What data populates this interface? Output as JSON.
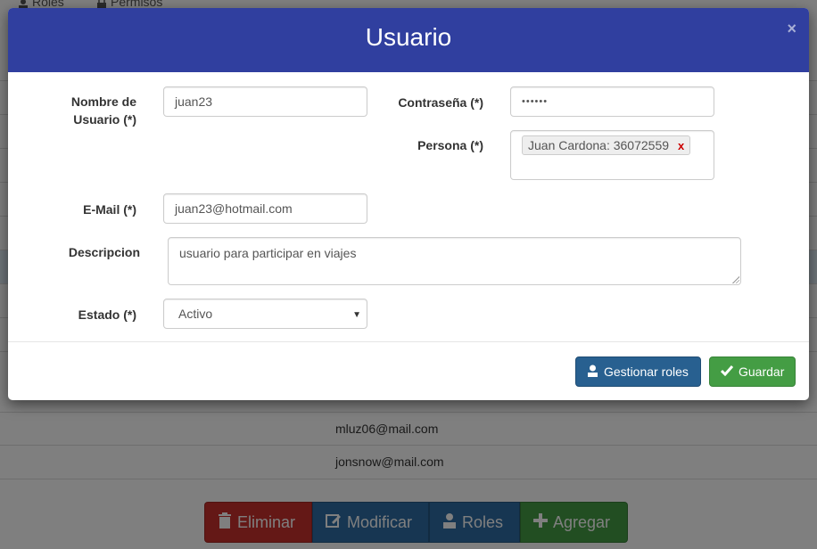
{
  "background": {
    "tabs": [
      {
        "label": "Roles",
        "icon": "user-icon"
      },
      {
        "label": "Permisos",
        "icon": "lock-icon"
      }
    ],
    "emails": [
      "mluz06@mail.com",
      "jonsnow@mail.com"
    ],
    "buttons": {
      "delete": "Eliminar",
      "modify": "Modificar",
      "roles": "Roles",
      "add": "Agregar"
    }
  },
  "modal": {
    "title": "Usuario",
    "close_icon": "×",
    "fields": {
      "username_label": "Nombre de Usuario (*)",
      "username_value": "juan23",
      "password_label": "Contraseña (*)",
      "password_value": "••••••",
      "persona_label": "Persona (*)",
      "persona_tag": "Juan Cardona: 36072559",
      "persona_tag_remove": "x",
      "email_label": "E-Mail (*)",
      "email_value": "juan23@hotmail.com",
      "description_label": "Descripcion",
      "description_value": "usuario para participar en viajes",
      "estado_label": "Estado (*)",
      "estado_value": "Activo"
    },
    "footer": {
      "manage_roles": "Gestionar roles",
      "save": "Guardar"
    }
  },
  "colors": {
    "header": "#303f9f",
    "primary": "#286090",
    "success": "#449d44",
    "danger": "#c9302c"
  }
}
